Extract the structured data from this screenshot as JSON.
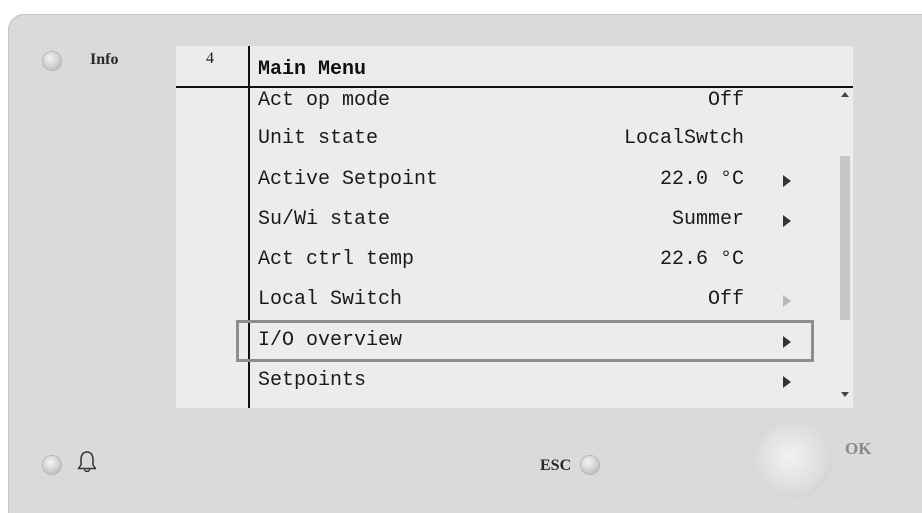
{
  "device": {
    "info_label": "Info",
    "esc_label": "ESC",
    "ok_label": "OK",
    "page_number": "4"
  },
  "menu": {
    "title": "Main Menu",
    "items": [
      {
        "label": "Act op mode",
        "value": "Off",
        "arrow": "none"
      },
      {
        "label": "Unit state",
        "value": "LocalSwtch",
        "arrow": "none"
      },
      {
        "label": "Active Setpoint",
        "value": "22.0 °C",
        "arrow": "dark"
      },
      {
        "label": "Su/Wi state",
        "value": "Summer",
        "arrow": "dark"
      },
      {
        "label": "Act ctrl temp",
        "value": "22.6 °C",
        "arrow": "none"
      },
      {
        "label": "Local Switch",
        "value": "Off",
        "arrow": "dim"
      },
      {
        "label": "I/O overview",
        "value": "",
        "arrow": "dark",
        "selected": true
      },
      {
        "label": "Setpoints",
        "value": "",
        "arrow": "dark"
      }
    ]
  },
  "icons": {
    "bell": "bell-icon",
    "scroll_up": "scroll-up-arrow-icon",
    "scroll_down": "scroll-down-arrow-icon",
    "submenu": "submenu-arrow-icon"
  },
  "colors": {
    "panel": "#dadada",
    "screen": "#ececec",
    "selection_border": "#8e8e8e",
    "text": "#1a1a1a"
  }
}
